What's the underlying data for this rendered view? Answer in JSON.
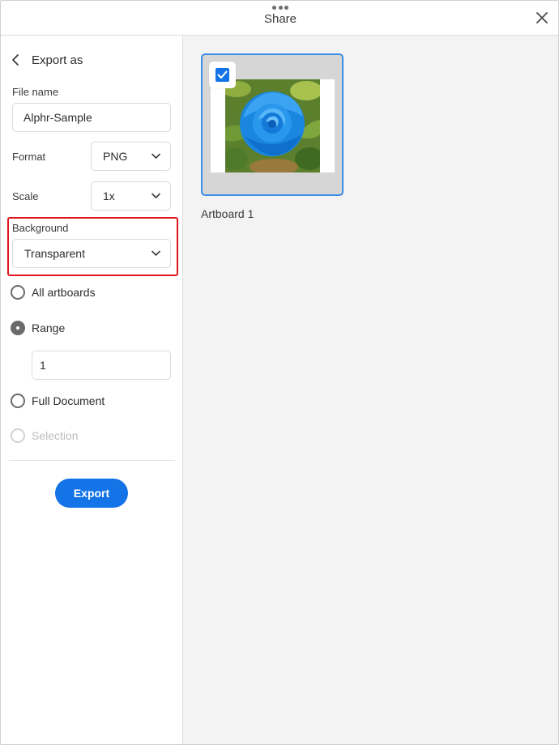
{
  "header": {
    "title": "Share"
  },
  "panel": {
    "back_title": "Export as",
    "file_name": {
      "label": "File name",
      "value": "Alphr-Sample"
    },
    "format": {
      "label": "Format",
      "value": "PNG"
    },
    "scale": {
      "label": "Scale",
      "value": "1x"
    },
    "background": {
      "label": "Background",
      "value": "Transparent"
    },
    "radios": {
      "all_artboards": "All artboards",
      "range": "Range",
      "range_value": "1",
      "full_document": "Full Document",
      "selection": "Selection"
    },
    "export_label": "Export"
  },
  "artboards": [
    {
      "name": "Artboard 1",
      "checked": true
    }
  ],
  "colors": {
    "accent": "#1473e6",
    "highlight": "#e0161e",
    "rose": "#1e8fe8"
  },
  "icons": [
    "grip-dots-icon",
    "close-icon",
    "chevron-left-icon",
    "chevron-down-icon",
    "checkmark-icon"
  ]
}
